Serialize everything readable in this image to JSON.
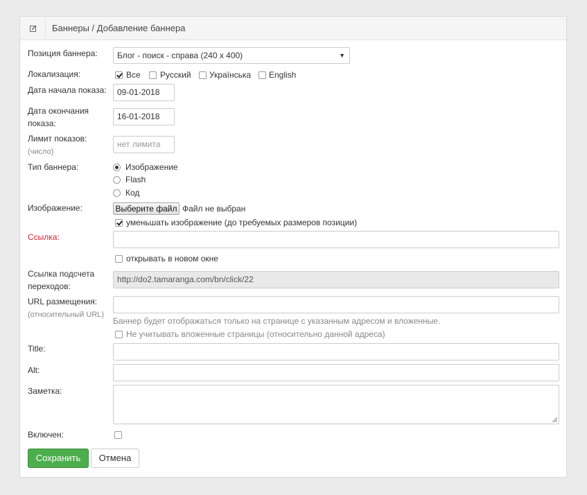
{
  "header": {
    "breadcrumb": "Баннеры / Добавление баннера",
    "icon": "edit-icon"
  },
  "form": {
    "position": {
      "label": "Позиция баннера:",
      "value": "Блог - поиск - справа (240 x 400)"
    },
    "localization": {
      "label": "Локализация:",
      "options": [
        {
          "label": "Все",
          "checked": true
        },
        {
          "label": "Русский",
          "checked": false
        },
        {
          "label": "Українська",
          "checked": false
        },
        {
          "label": "English",
          "checked": false
        }
      ]
    },
    "start_date": {
      "label": "Дата начала показа:",
      "value": "09-01-2018"
    },
    "end_date": {
      "label_line1": "Дата окончания",
      "label_line2": "показа:",
      "value": "16-01-2018"
    },
    "impressions_limit": {
      "label": "Лимит показов:",
      "sublabel": "(число)",
      "placeholder": "нет лимита"
    },
    "banner_type": {
      "label": "Тип баннера:",
      "options": [
        {
          "label": "Изображение",
          "selected": true
        },
        {
          "label": "Flash",
          "selected": false
        },
        {
          "label": "Код",
          "selected": false
        }
      ]
    },
    "image": {
      "label": "Изображение:",
      "button": "Выберите файл",
      "file_status": "Файл не выбран",
      "resize_label": "уменьшать изображение (до требуемых размеров позиции)",
      "resize_checked": true
    },
    "link": {
      "label": "Ссылка:",
      "value": "",
      "new_window_label": "открывать в новом окне",
      "new_window_checked": false
    },
    "tracking_link": {
      "label_line1": "Ссылка подсчета",
      "label_line2": "переходов:",
      "value": "http://do2.tamaranga.com/bn/click/22"
    },
    "placement_url": {
      "label": "URL размещения:",
      "sublabel": "(относительный URL)",
      "value": "",
      "hint": "Баннер будет отображаться только на странице с указанным адресом и вложенные.",
      "ignore_nested_label": "Не учитывать вложенные страницы (относительно данной адреса)",
      "ignore_nested_checked": false
    },
    "title": {
      "label": "Title:",
      "value": ""
    },
    "alt": {
      "label": "Alt:",
      "value": ""
    },
    "note": {
      "label": "Заметка:",
      "value": ""
    },
    "enabled": {
      "label": "Включен:",
      "checked": false
    }
  },
  "actions": {
    "save": "Сохранить",
    "cancel": "Отмена"
  },
  "colors": {
    "save_button": "#4cae4c",
    "required_label": "#d9232d",
    "background": "#ebebeb"
  }
}
